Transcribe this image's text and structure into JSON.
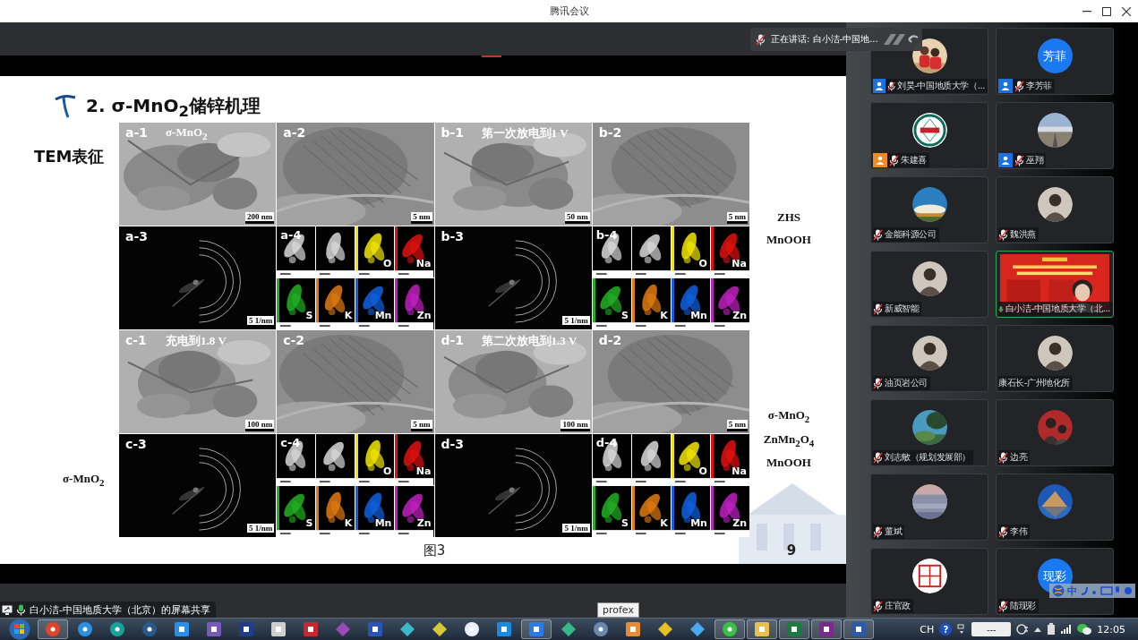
{
  "window": {
    "title": "腾讯会议"
  },
  "speaker": {
    "text": "正在讲话: 白小洁-中国地..."
  },
  "slide": {
    "title": "2. σ-MnO$_{2}$储锌机理",
    "method": "TEM表征",
    "left_notes": [
      "σ-MnO$_{2}$"
    ],
    "right_groups": [
      {
        "lines": [
          "ZHS",
          "MnOOH"
        ]
      },
      {
        "lines": [
          "σ-MnO$_{2}$",
          "ZnMn$_{2}$O$_{4}$",
          "MnOOH"
        ]
      }
    ],
    "figure": {
      "panels": [
        {
          "label": "a-1",
          "kind": "tem",
          "caption": "σ-MnO$_{2}$",
          "scale": "200 nm"
        },
        {
          "label": "a-2",
          "kind": "hrtem",
          "scale": "5 nm"
        },
        {
          "label": "b-1",
          "kind": "tem",
          "caption": "第一次放电到1 V",
          "scale": "50 nm"
        },
        {
          "label": "b-2",
          "kind": "hrtem",
          "scale": "5 nm"
        },
        {
          "label": "a-3",
          "kind": "diffraction",
          "scale": "5 1/nm"
        },
        {
          "label": "a-4",
          "kind": "eds",
          "maps": [
            {
              "kind": "gray"
            },
            {
              "kind": "gray"
            },
            {
              "kind": "element",
              "label": "O",
              "color": "#f2e600"
            },
            {
              "kind": "element",
              "label": "Na",
              "color": "#e01010"
            },
            {
              "kind": "element",
              "label": "S",
              "color": "#22b022"
            },
            {
              "kind": "element",
              "label": "K",
              "color": "#e07a10"
            },
            {
              "kind": "element",
              "label": "Mn",
              "color": "#1060e0"
            },
            {
              "kind": "element",
              "label": "Zn",
              "color": "#c020c0"
            }
          ]
        },
        {
          "label": "b-3",
          "kind": "diffraction",
          "scale": "5 1/nm"
        },
        {
          "label": "b-4",
          "kind": "eds",
          "maps": [
            {
              "kind": "gray"
            },
            {
              "kind": "gray"
            },
            {
              "kind": "element",
              "label": "O",
              "color": "#f2e600"
            },
            {
              "kind": "element",
              "label": "Na",
              "color": "#e01010"
            },
            {
              "kind": "element",
              "label": "S",
              "color": "#22b022"
            },
            {
              "kind": "element",
              "label": "K",
              "color": "#e07a10"
            },
            {
              "kind": "element",
              "label": "Mn",
              "color": "#1060e0"
            },
            {
              "kind": "element",
              "label": "Zn",
              "color": "#c020c0"
            }
          ]
        },
        {
          "label": "c-1",
          "kind": "tem",
          "caption": "充电到1.8 V",
          "scale": "100 nm"
        },
        {
          "label": "c-2",
          "kind": "hrtem",
          "scale": "5 nm"
        },
        {
          "label": "d-1",
          "kind": "tem",
          "caption": "第二次放电到1.3 V",
          "scale": "100 nm"
        },
        {
          "label": "d-2",
          "kind": "hrtem",
          "scale": "5 nm"
        },
        {
          "label": "c-3",
          "kind": "diffraction",
          "scale": "5 1/nm"
        },
        {
          "label": "c-4",
          "kind": "eds",
          "maps": [
            {
              "kind": "gray"
            },
            {
              "kind": "gray"
            },
            {
              "kind": "element",
              "label": "O",
              "color": "#f2e600"
            },
            {
              "kind": "element",
              "label": "Na",
              "color": "#e01010"
            },
            {
              "kind": "element",
              "label": "S",
              "color": "#22b022"
            },
            {
              "kind": "element",
              "label": "K",
              "color": "#e07a10"
            },
            {
              "kind": "element",
              "label": "Mn",
              "color": "#1060e0"
            },
            {
              "kind": "element",
              "label": "Zn",
              "color": "#c020c0"
            }
          ]
        },
        {
          "label": "d-3",
          "kind": "diffraction",
          "scale": "5 1/nm"
        },
        {
          "label": "d-4",
          "kind": "eds",
          "maps": [
            {
              "kind": "gray"
            },
            {
              "kind": "gray"
            },
            {
              "kind": "element",
              "label": "O",
              "color": "#f2e600"
            },
            {
              "kind": "element",
              "label": "Na",
              "color": "#e01010"
            },
            {
              "kind": "element",
              "label": "S",
              "color": "#22b022"
            },
            {
              "kind": "element",
              "label": "K",
              "color": "#e07a10"
            },
            {
              "kind": "element",
              "label": "Mn",
              "color": "#1060e0"
            },
            {
              "kind": "element",
              "label": "Zn",
              "color": "#c020c0"
            }
          ]
        }
      ]
    },
    "caption": "图3",
    "page": "9"
  },
  "participants": [
    {
      "name": "刘昊-中国地质大学（...",
      "badge": {
        "color": "#1e6fe0"
      },
      "mic": {
        "muted": true
      },
      "speaking": false
    },
    {
      "name": "李芳菲",
      "avatar": {
        "kind": "text",
        "text": "芳菲"
      },
      "badge": {
        "color": "#1e6fe0"
      },
      "mic": {
        "muted": true
      },
      "speaking": false
    },
    {
      "name": "朱建喜",
      "badge": {
        "color": "#f08a24"
      },
      "mic": {
        "muted": true
      },
      "speaking": false
    },
    {
      "name": "巫翔",
      "badge": {
        "color": "#1e6fe0"
      },
      "mic": {
        "muted": true
      },
      "speaking": false
    },
    {
      "name": "金能科源公司",
      "mic": {
        "muted": true
      },
      "speaking": false
    },
    {
      "name": "魏洪燕",
      "mic": {
        "muted": true
      },
      "speaking": false
    },
    {
      "name": "新威智能",
      "mic": {
        "muted": true
      },
      "speaking": false
    },
    {
      "name": "白小洁-中国地质大学（北...",
      "avatar": {
        "kind": "video"
      },
      "mic": {
        "muted": false
      },
      "speaking": true
    },
    {
      "name": "油页岩公司",
      "mic": {
        "muted": true
      },
      "speaking": false
    },
    {
      "name": "康石长-广州地化所",
      "speaking": false
    },
    {
      "name": "刘志敏（规划发展部）",
      "mic": {
        "muted": true
      },
      "speaking": false
    },
    {
      "name": "边亮",
      "mic": {
        "muted": true
      },
      "speaking": false
    },
    {
      "name": "董斌",
      "mic": {
        "muted": true
      },
      "speaking": false
    },
    {
      "name": "李伟",
      "mic": {
        "muted": true
      },
      "speaking": false
    },
    {
      "name": "庄官政",
      "mic": {
        "muted": true
      },
      "speaking": false
    },
    {
      "name": "陆现彩",
      "avatar": {
        "kind": "text",
        "text": "现彩"
      },
      "mic": {
        "muted": true
      },
      "speaking": false
    }
  ],
  "share": {
    "text": "白小洁-中国地质大学（北京）的屏幕共享"
  },
  "tooltip": "profex",
  "ime": {
    "mode": "中"
  },
  "taskbar": {
    "apps": [
      {
        "kind": "circle",
        "color": "#e0452c",
        "open": true
      },
      {
        "kind": "circle",
        "color": "#2d8fe0",
        "open": false
      },
      {
        "kind": "circle",
        "color": "#17a39a",
        "open": false
      },
      {
        "kind": "circle",
        "color": "#2a5a8a",
        "open": false
      },
      {
        "kind": "square",
        "color": "#2b8ee8",
        "open": false
      },
      {
        "kind": "square",
        "color": "#7a5ab8",
        "open": false
      },
      {
        "kind": "square",
        "color": "#1d3f8a",
        "open": false
      },
      {
        "kind": "square",
        "color": "#cfcfcf",
        "open": false
      },
      {
        "kind": "square",
        "color": "#c8282d",
        "open": false
      },
      {
        "kind": "diamond",
        "color": "#9a4ab8",
        "open": false
      },
      {
        "kind": "square",
        "color": "#2a55b8",
        "open": false
      },
      {
        "kind": "diamond",
        "color": "#3ab8c8",
        "open": false
      },
      {
        "kind": "diamond",
        "color": "#d8c838",
        "open": false
      },
      {
        "kind": "circle",
        "color": "#e8f0ff",
        "open": false
      },
      {
        "kind": "square",
        "color": "#1a8ae0",
        "open": false
      },
      {
        "kind": "square",
        "color": "#2a7ae8",
        "open": true
      },
      {
        "kind": "diamond",
        "color": "#38b888",
        "open": false
      },
      {
        "kind": "circle",
        "color": "#6a88b0",
        "open": false
      },
      {
        "kind": "square",
        "color": "#e88a38",
        "open": false
      },
      {
        "kind": "diamond",
        "color": "#e8c020",
        "open": false
      },
      {
        "kind": "diamond",
        "color": "#48a8f0",
        "open": false
      },
      {
        "kind": "circle",
        "color": "#3cc048",
        "open": true
      },
      {
        "kind": "square",
        "color": "#e8c050",
        "open": true
      },
      {
        "kind": "square",
        "color": "#1d7a3e",
        "open": true
      },
      {
        "kind": "square",
        "color": "#7a2a8a",
        "open": true
      },
      {
        "kind": "square",
        "color": "#2a5aa8",
        "open": true
      }
    ],
    "language": "CH",
    "help": "?",
    "tray_box": "---",
    "clock": "12:05"
  }
}
